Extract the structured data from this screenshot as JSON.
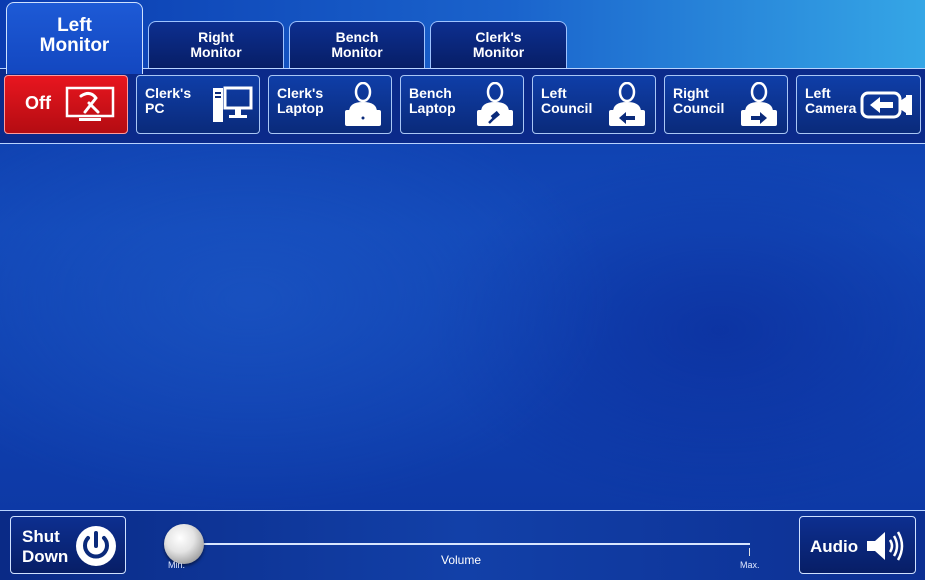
{
  "tabs": [
    {
      "label_line1": "Left",
      "label_line2": "Monitor",
      "active": true
    },
    {
      "label_line1": "Right",
      "label_line2": "Monitor",
      "active": false
    },
    {
      "label_line1": "Bench",
      "label_line2": "Monitor",
      "active": false
    },
    {
      "label_line1": "Clerk's",
      "label_line2": "Monitor",
      "active": false
    }
  ],
  "sources": [
    {
      "label_line1": "Off",
      "label_line2": "",
      "icon": "monitor-off-icon",
      "color": "#d41118"
    },
    {
      "label_line1": "Clerk's",
      "label_line2": "PC",
      "icon": "desktop-pc-icon"
    },
    {
      "label_line1": "Clerk's",
      "label_line2": "Laptop",
      "icon": "person-laptop-icon"
    },
    {
      "label_line1": "Bench",
      "label_line2": "Laptop",
      "icon": "person-gavel-laptop-icon"
    },
    {
      "label_line1": "Left",
      "label_line2": "Council",
      "icon": "person-left-arrow-icon"
    },
    {
      "label_line1": "Right",
      "label_line2": "Council",
      "icon": "person-right-arrow-icon"
    },
    {
      "label_line1": "Left",
      "label_line2": "Camera",
      "icon": "camera-left-arrow-icon"
    }
  ],
  "footer": {
    "shutdown_line1": "Shut",
    "shutdown_line2": "Down",
    "volume_label": "Volume",
    "volume_min": "Min.",
    "volume_max": "Max.",
    "volume_level": 0,
    "audio_label": "Audio"
  },
  "colors": {
    "accent_blue": "#1347c0",
    "off_red": "#d41118"
  }
}
